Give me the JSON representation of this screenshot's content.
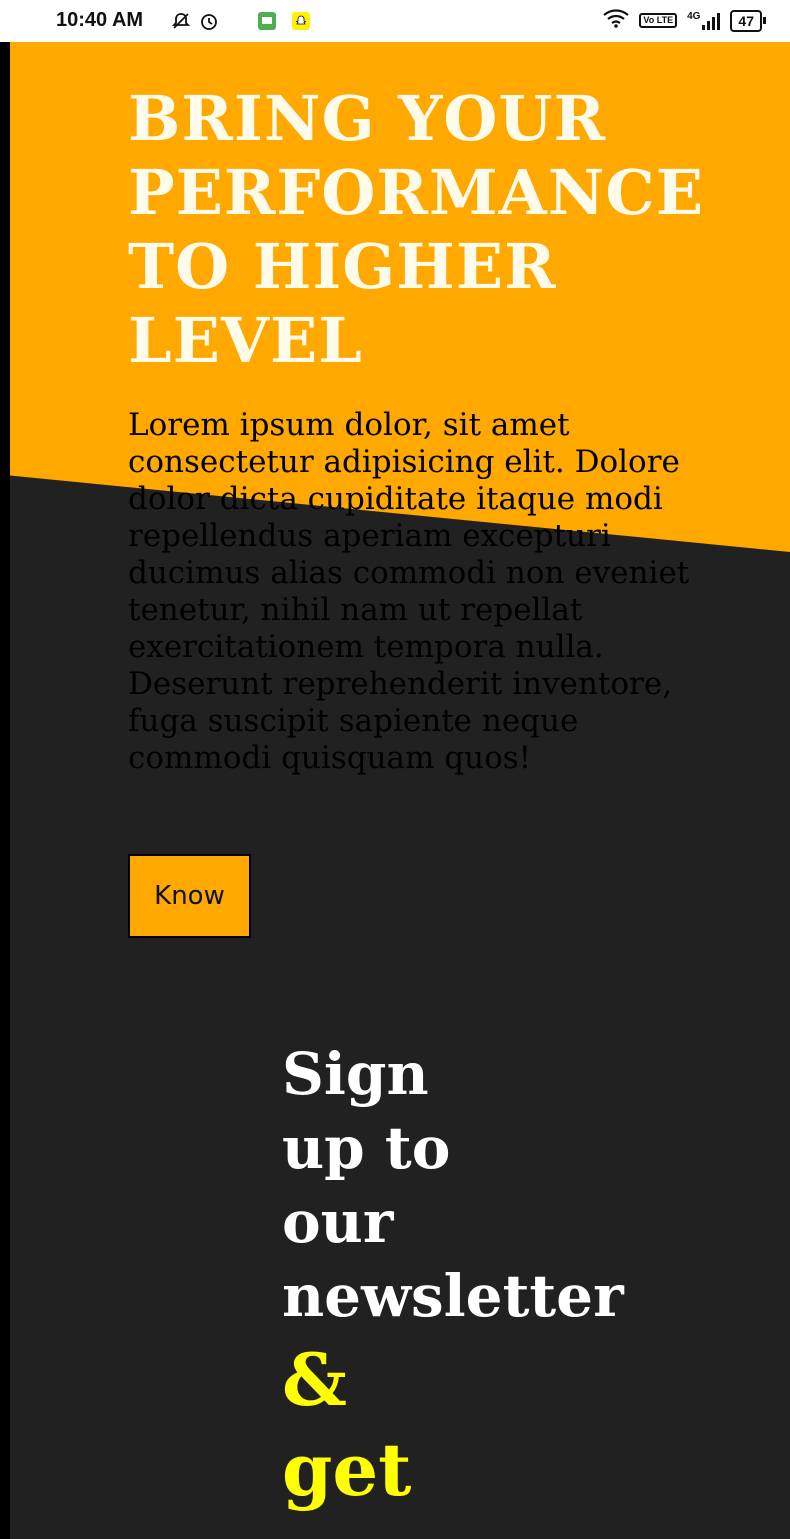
{
  "status_bar": {
    "time": "10:40 AM",
    "icons": [
      "notifications-off-icon",
      "alarm-icon",
      "message-icon",
      "snapchat-icon"
    ],
    "volte": "Vo LTE",
    "network": "4G",
    "battery": "47"
  },
  "hero": {
    "title_lines": [
      "BRING YOUR",
      "PERFORMANCE",
      "TO HIGHER",
      "LEVEL"
    ],
    "body": "Lorem ipsum dolor, sit amet consectetur adipisicing elit. Dolore dolor dicta cupiditate itaque modi repellendus aperiam excepturi ducimus alias commodi non eveniet tenetur, nihil nam ut repellat exercitationem tempora nulla. Deserunt reprehenderit inventore, fuga suscipit sapiente neque commodi quisquam quos!",
    "button_label": "Know"
  },
  "newsletter": {
    "white_lines": [
      "Sign",
      "up to",
      "our",
      "newsletter"
    ],
    "yellow_lines": [
      "&",
      "get"
    ]
  },
  "colors": {
    "accent": "#ffa800",
    "background": "#212121",
    "title_text": "#fffbea",
    "highlight": "#ffff00"
  }
}
